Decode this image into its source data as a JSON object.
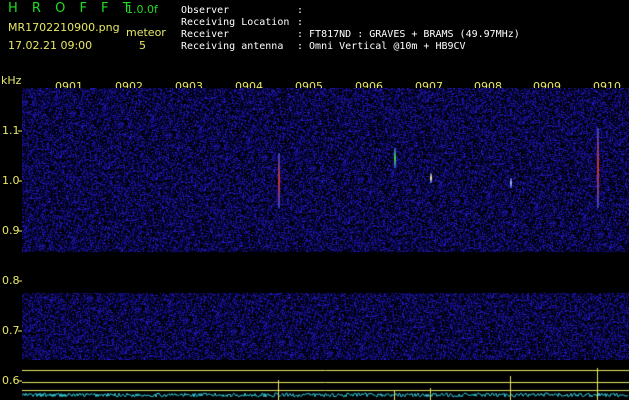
{
  "app": {
    "title": "H R O F F T",
    "version": "1.0.0f",
    "filename": "MR1702210900.png",
    "datetime": "17.02.21 09:00",
    "meteor_label": "meteor",
    "meteor_count": "5"
  },
  "info": {
    "observer_label": "Observer",
    "observer_value": ":",
    "location_label": "Receiving Location",
    "location_value": ":",
    "receiver_label": "Receiver",
    "receiver_value": ":  FT817ND : GRAVES + BRAMS (49.97MHz)",
    "antenna_label": "Receiving antenna",
    "antenna_value": ":  Omni Vertical @10m + HB9CV"
  },
  "axis": {
    "unit": "kHz",
    "y_ticks": [
      "1.1",
      "1.0",
      "0.9",
      "0.8",
      "0.7",
      "0.6"
    ],
    "x_ticks": [
      "0901",
      "0902",
      "0903",
      "0904",
      "0905",
      "0906",
      "0907",
      "0908",
      "0909",
      "0910"
    ]
  },
  "colors": {
    "background": "#000000",
    "label_yellow": "#e8e864",
    "title_green": "#22dd22",
    "noise_blue": "#2a2ab0",
    "trace_cyan": "#33ccdd"
  }
}
